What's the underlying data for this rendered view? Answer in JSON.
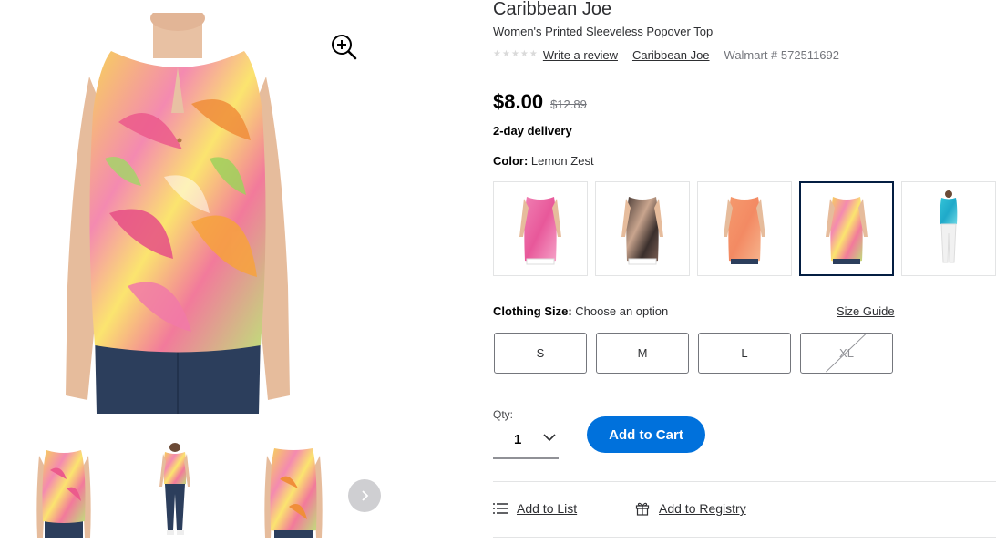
{
  "product": {
    "brand": "Caribbean Joe",
    "title": "Women's Printed Sleeveless Popover Top",
    "rating_stars": 5,
    "write_review": "Write a review",
    "brand_link": "Caribbean Joe",
    "sku": "Walmart # 572511692",
    "price": "$8.00",
    "was_price": "$12.89",
    "delivery": "2-day delivery"
  },
  "color": {
    "label": "Color:",
    "value": "Lemon Zest",
    "swatches": [
      {
        "name": "pink-print",
        "selected": false
      },
      {
        "name": "dark-floral",
        "selected": false
      },
      {
        "name": "coral-print",
        "selected": false
      },
      {
        "name": "lemon-zest",
        "selected": true
      },
      {
        "name": "aqua-print",
        "selected": false
      }
    ]
  },
  "size": {
    "label": "Clothing Size:",
    "value": "Choose an option",
    "guide": "Size Guide",
    "options": [
      {
        "label": "S",
        "available": true
      },
      {
        "label": "M",
        "available": true
      },
      {
        "label": "L",
        "available": true
      },
      {
        "label": "XL",
        "available": false
      }
    ]
  },
  "quantity": {
    "label": "Qty:",
    "value": "1"
  },
  "cart": {
    "button": "Add to Cart"
  },
  "actions": {
    "list": "Add to List",
    "registry": "Add to Registry"
  },
  "icons": {
    "zoom": "zoom-in-icon",
    "next": "chevron-right-icon",
    "list": "list-icon",
    "registry": "gift-icon",
    "qty": "chevron-down-icon"
  },
  "colors": {
    "accent": "#0071dc",
    "selected_border": "#041e42",
    "text": "#2e2f32",
    "muted": "#74767c"
  }
}
